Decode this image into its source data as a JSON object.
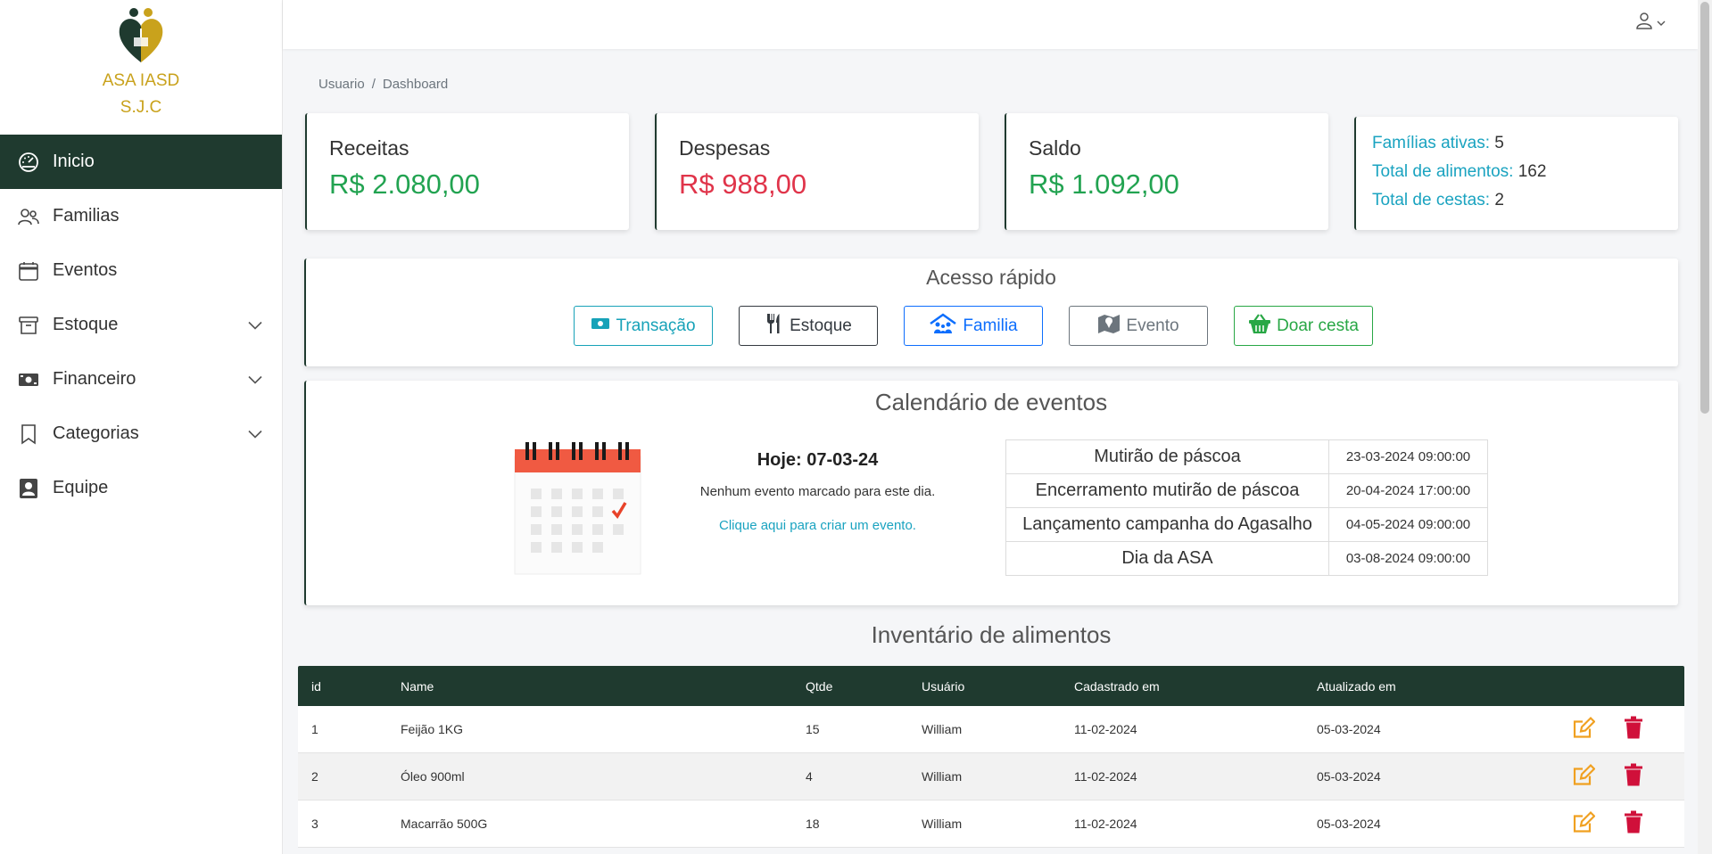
{
  "brand": {
    "line1": "ASA IASD",
    "line2": "S.J.C"
  },
  "sidebar": {
    "items": [
      {
        "label": "Inicio",
        "icon": "dashboard-gauge-icon",
        "active": true
      },
      {
        "label": "Familias",
        "icon": "people-icon"
      },
      {
        "label": "Eventos",
        "icon": "calendar-icon"
      },
      {
        "label": "Estoque",
        "icon": "archive-box-icon",
        "expandable": true
      },
      {
        "label": "Financeiro",
        "icon": "cash-icon",
        "expandable": true
      },
      {
        "label": "Categorias",
        "icon": "bookmark-icon",
        "expandable": true
      },
      {
        "label": "Equipe",
        "icon": "person-badge-icon"
      }
    ]
  },
  "breadcrumb": {
    "first": "Usuario",
    "separator": "/",
    "current": "Dashboard"
  },
  "stats": {
    "receitas": {
      "label": "Receitas",
      "value": "R$ 2.080,00"
    },
    "despesas": {
      "label": "Despesas",
      "value": "R$ 988,00"
    },
    "saldo": {
      "label": "Saldo",
      "value": "R$ 1.092,00"
    },
    "summary": {
      "familias_label": "Famílias ativas:",
      "familias_value": "5",
      "alimentos_label": "Total de alimentos:",
      "alimentos_value": "162",
      "cestas_label": "Total de cestas:",
      "cestas_value": "2"
    }
  },
  "quick_access": {
    "title": "Acesso rápido",
    "buttons": [
      {
        "label": "Transação",
        "color": "#17a2b8"
      },
      {
        "label": "Estoque",
        "color": "#343a40"
      },
      {
        "label": "Familia",
        "color": "#0d6efd"
      },
      {
        "label": "Evento",
        "color": "#6c757d"
      },
      {
        "label": "Doar cesta",
        "color": "#28a745"
      }
    ]
  },
  "calendar": {
    "title": "Calendário de eventos",
    "today": "Hoje: 07-03-24",
    "no_event": "Nenhum evento marcado para este dia.",
    "create_link": "Clique aqui para criar um evento.",
    "events": [
      {
        "name": "Mutirão de páscoa",
        "date": "23-03-2024 09:00:00"
      },
      {
        "name": "Encerramento mutirão de páscoa",
        "date": "20-04-2024 17:00:00"
      },
      {
        "name": "Lançamento campanha do Agasalho",
        "date": "04-05-2024 09:00:00"
      },
      {
        "name": "Dia da ASA",
        "date": "03-08-2024 09:00:00"
      }
    ]
  },
  "inventory": {
    "title": "Inventário de alimentos",
    "columns": [
      "id",
      "Name",
      "Qtde",
      "Usuário",
      "Cadastrado em",
      "Atualizado em"
    ],
    "rows": [
      [
        "1",
        "Feijão 1KG",
        "15",
        "William",
        "11-02-2024",
        "05-03-2024"
      ],
      [
        "2",
        "Óleo 900ml",
        "4",
        "William",
        "11-02-2024",
        "05-03-2024"
      ],
      [
        "3",
        "Macarrão 500G",
        "18",
        "William",
        "11-02-2024",
        "05-03-2024"
      ]
    ]
  },
  "colors": {
    "primary_dark": "#1f3a2f",
    "brand_gold": "#c9a21c",
    "positive": "#22a351",
    "negative": "#e0344a",
    "info": "#1aa3c0",
    "edit": "#f0a020",
    "delete": "#d0103a"
  }
}
